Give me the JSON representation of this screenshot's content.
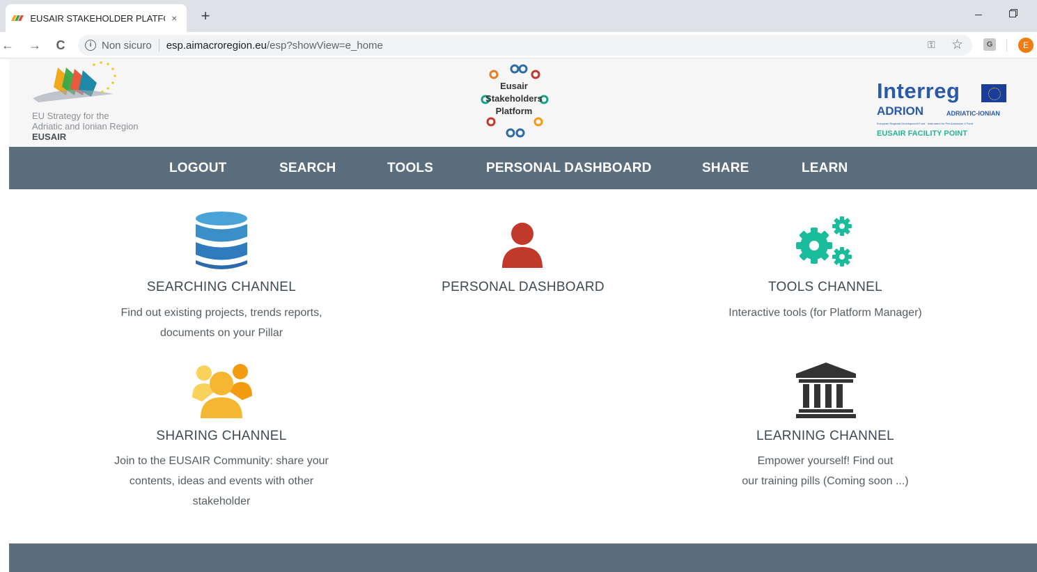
{
  "browser": {
    "tab_title": "EUSAIR STAKEHOLDER PLATFORM",
    "tab_close": "×",
    "new_tab": "+",
    "back": "←",
    "forward": "→",
    "reload": "C",
    "security_info": "i",
    "security_label": "Non sicuro",
    "url_host": "esp.aimacroregion.eu",
    "url_path": "/esp?showView=e_home",
    "extension_label": "G",
    "avatar_initial": "E"
  },
  "header": {
    "eusair_line1": "EU Strategy for the",
    "eusair_line2": "Adriatic and Ionian Region",
    "eusair_short": "EUSAIR",
    "esp_line1": "Eusair",
    "esp_line2": "Stakeholders",
    "esp_line3": "Platform",
    "interreg_title": "Interreg",
    "adrion": "ADRION",
    "adriatic_ionian": "ADRIATIC-IONIAN",
    "erdf_note": "European Regional Development Fund · Instrument for Pre-Accession II Fund",
    "facility_point": "EUSAIR FACILITY POINT"
  },
  "nav": {
    "items": [
      {
        "label": "LOGOUT"
      },
      {
        "label": "SEARCH"
      },
      {
        "label": "TOOLS"
      },
      {
        "label": "PERSONAL DASHBOARD"
      },
      {
        "label": "SHARE"
      },
      {
        "label": "LEARN"
      }
    ]
  },
  "channels": {
    "searching": {
      "title": "SEARCHING CHANNEL",
      "desc_line1": "Find out existing projects, trends reports,",
      "desc_line2": "documents on your Pillar",
      "icon": "database-icon",
      "color": "#3a8fc9"
    },
    "dashboard": {
      "title": "PERSONAL DASHBOARD",
      "icon": "user-icon",
      "color": "#c0392b"
    },
    "tools": {
      "title": "TOOLS CHANNEL",
      "desc_line1": "Interactive tools (for Platform Manager)",
      "icon": "gears-icon",
      "color": "#1abc9c"
    },
    "sharing": {
      "title": "SHARING CHANNEL",
      "desc_line1": "Join to the EUSAIR Community: share your",
      "desc_line2": "contents, ideas and events with other",
      "desc_line3": "stakeholder",
      "icon": "users-icon",
      "color": "#f5b731"
    },
    "learning": {
      "title": "LEARNING CHANNEL",
      "desc_line1": "Empower yourself! Find out",
      "desc_line2": "our training pills (Coming soon ...)",
      "icon": "institution-icon",
      "color": "#333333"
    }
  }
}
